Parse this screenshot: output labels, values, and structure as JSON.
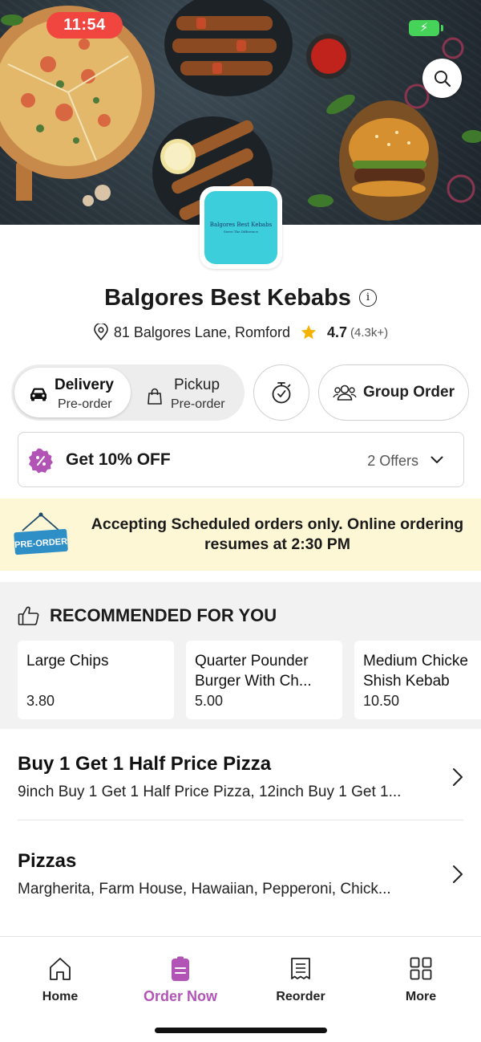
{
  "status_bar": {
    "time": "11:54",
    "battery_icon": "battery-charging-icon"
  },
  "header": {
    "search_icon": "search-icon"
  },
  "restaurant": {
    "logo_text_line1": "Balgores Best Kebabs",
    "logo_text_line2": "Serve The Difference",
    "name": "Balgores Best Kebabs",
    "address": "81 Balgores Lane, Romford",
    "rating": "4.7",
    "rating_count": "(4.3k+)"
  },
  "order_mode": {
    "delivery": {
      "label": "Delivery",
      "sub": "Pre-order",
      "selected": true
    },
    "pickup": {
      "label": "Pickup",
      "sub": "Pre-order",
      "selected": false
    }
  },
  "group_order": {
    "label": "Group Order"
  },
  "offers": {
    "label": "Get 10% OFF",
    "count": "2 Offers"
  },
  "preorder_banner": {
    "sign_text": "PRE-ORDER",
    "message": "Accepting Scheduled orders only. Online ordering resumes at 2:30 PM"
  },
  "recommended": {
    "heading": "RECOMMENDED FOR YOU",
    "items": [
      {
        "name_line1": "Large Chips",
        "name_line2": "",
        "price": "3.80"
      },
      {
        "name_line1": "Quarter Pounder",
        "name_line2": "Burger With Ch...",
        "price": "5.00"
      },
      {
        "name_line1": "Medium Chicke",
        "name_line2": "Shish Kebab",
        "price": "10.50"
      }
    ]
  },
  "categories": [
    {
      "name": "Buy 1 Get 1 Half Price Pizza",
      "desc": "9inch Buy 1 Get 1 Half Price Pizza, 12inch Buy 1 Get 1..."
    },
    {
      "name": "Pizzas",
      "desc": "Margherita, Farm House, Hawaiian, Pepperoni, Chick..."
    }
  ],
  "bottom_nav": [
    {
      "label": "Home",
      "icon": "home-icon"
    },
    {
      "label": "Order Now",
      "icon": "order-icon",
      "active": true
    },
    {
      "label": "Reorder",
      "icon": "receipt-icon"
    },
    {
      "label": "More",
      "icon": "grid-icon"
    }
  ],
  "colors": {
    "accent": "#b154b6",
    "time_pill": "#f0463f",
    "banner_bg": "#fdf7d6",
    "logo_bg": "#3ccfdb",
    "star": "#f5b301"
  }
}
